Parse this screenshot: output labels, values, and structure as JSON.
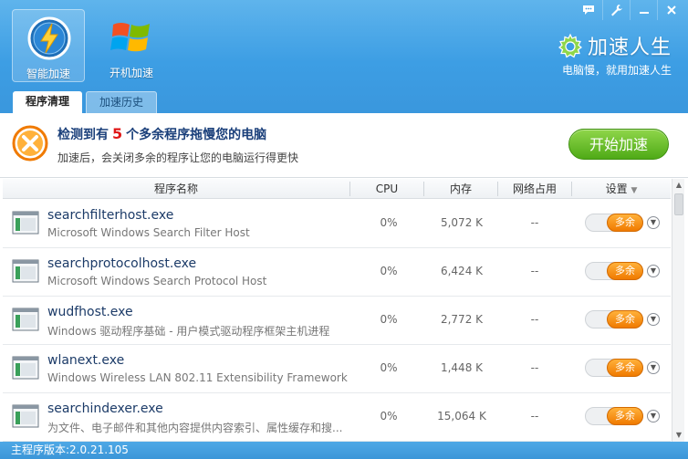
{
  "header": {
    "modes": [
      {
        "label": "智能加速",
        "icon": "lightning-speedometer-icon",
        "active": true
      },
      {
        "label": "开机加速",
        "icon": "windows-logo-icon",
        "active": false
      }
    ],
    "brand_name": "加速人生",
    "brand_slogan": "电脑慢，就用加速人生",
    "window_controls": [
      "message-icon",
      "settings-wrench-icon",
      "minimize-icon",
      "close-icon"
    ]
  },
  "tabs": [
    {
      "label": "程序清理",
      "active": true
    },
    {
      "label": "加速历史",
      "active": false
    }
  ],
  "alert": {
    "prefix": "检测到有",
    "count": "5",
    "suffix": "个多余程序拖慢您的电脑",
    "detail": "加速后，会关闭多余的程序让您的电脑运行得更快",
    "button": "开始加速"
  },
  "table": {
    "columns": {
      "name": "程序名称",
      "cpu": "CPU",
      "memory": "内存",
      "network": "网络占用",
      "settings": "设置"
    },
    "rows": [
      {
        "name": "searchfilterhost.exe",
        "desc": "Microsoft Windows Search Filter Host",
        "cpu": "0%",
        "memory": "5,072 K",
        "network": "--",
        "toggle": "多余"
      },
      {
        "name": "searchprotocolhost.exe",
        "desc": "Microsoft Windows Search Protocol Host",
        "cpu": "0%",
        "memory": "6,424 K",
        "network": "--",
        "toggle": "多余"
      },
      {
        "name": "wudfhost.exe",
        "desc": "Windows 驱动程序基础 - 用户模式驱动程序框架主机进程",
        "cpu": "0%",
        "memory": "2,772 K",
        "network": "--",
        "toggle": "多余"
      },
      {
        "name": "wlanext.exe",
        "desc": "Windows Wireless LAN 802.11 Extensibility Framework",
        "cpu": "0%",
        "memory": "1,448 K",
        "network": "--",
        "toggle": "多余"
      },
      {
        "name": "searchindexer.exe",
        "desc": "为文件、电子邮件和其他内容提供内容索引、属性缓存和搜...",
        "cpu": "0%",
        "memory": "15,064 K",
        "network": "--",
        "toggle": "多余"
      }
    ]
  },
  "footer": {
    "version": "主程序版本:2.0.21.105"
  },
  "colors": {
    "header_blue": "#3d9ee4",
    "accent_green": "#4faa17",
    "toggle_orange": "#f07a00",
    "alert_red": "#e01818"
  }
}
